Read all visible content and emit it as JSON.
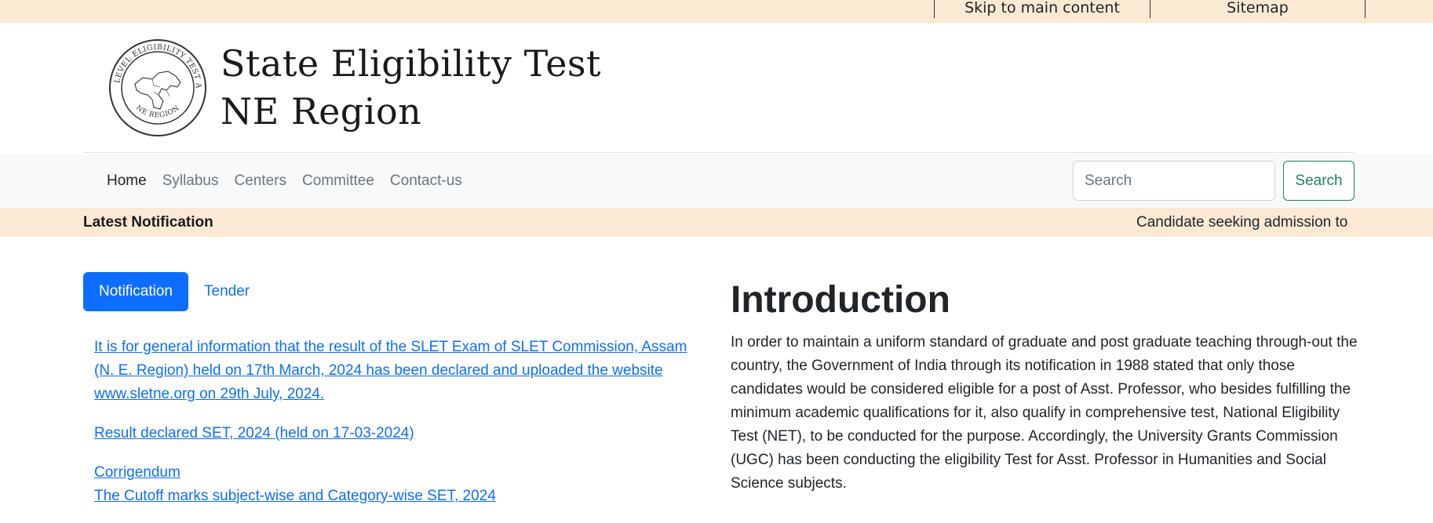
{
  "utility_links": {
    "skip": "Skip to main content",
    "sitemap": "Sitemap"
  },
  "header": {
    "title_line1": "State Eligibility Test",
    "title_line2": "NE Region",
    "seal_text_top": "STATE LEVEL ELIGIBILITY TEST ASSAM",
    "seal_text_bottom": "NE REGION"
  },
  "nav": {
    "items": [
      {
        "label": "Home",
        "active": true
      },
      {
        "label": "Syllabus",
        "active": false
      },
      {
        "label": "Centers",
        "active": false
      },
      {
        "label": "Committee",
        "active": false
      },
      {
        "label": "Contact-us",
        "active": false
      }
    ],
    "search": {
      "placeholder": "Search",
      "button_label": "Search"
    }
  },
  "ticker": {
    "label": "Latest Notification",
    "text": "Candidate seeking admission to"
  },
  "tabs": [
    {
      "label": "Notification",
      "active": true
    },
    {
      "label": "Tender",
      "active": false
    }
  ],
  "notifications": [
    "It is for general information that the result of the SLET Exam of SLET Commission, Assam (N. E. Region) held on 17th March, 2024 has been declared and uploaded the website www.sletne.org on 29th July, 2024.",
    "Result declared SET, 2024 (held on 17-03-2024)",
    "Corrigendum",
    "The Cutoff marks subject-wise and Category-wise SET, 2024"
  ],
  "intro": {
    "title": "Introduction",
    "body": "In order to maintain a uniform standard of graduate and post graduate teaching through-out the country, the Government of India through its notification in 1988 stated that only those candidates would be considered eligible for a post of Asst. Professor, who besides fulfilling the minimum academic qualifications for it, also qualify in comprehensive test, National Eligibility Test (NET), to be conducted for the purpose. Accordingly, the University Grants Commission (UGC) has been conducting the eligibility Test for Asst. Professor in Humanities and Social Science subjects."
  },
  "colors": {
    "accent_strip": "#fbe9d4",
    "primary": "#0d6efd",
    "success": "#198754"
  }
}
